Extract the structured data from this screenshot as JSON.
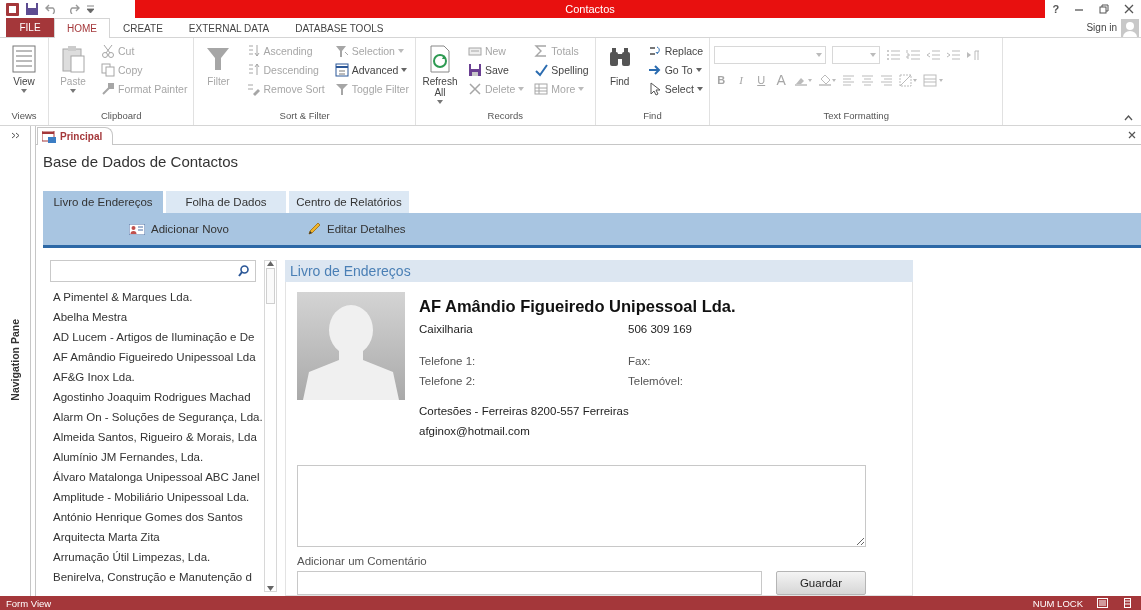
{
  "window": {
    "title": "Contactos",
    "help": "?"
  },
  "ribbon": {
    "file_tab": "FILE",
    "sign_in": "Sign in",
    "tabs": [
      {
        "label": "HOME",
        "selected": true
      },
      {
        "label": "CREATE",
        "selected": false
      },
      {
        "label": "EXTERNAL DATA",
        "selected": false
      },
      {
        "label": "DATABASE TOOLS",
        "selected": false
      }
    ],
    "groups": [
      {
        "name": "Views",
        "commands": [
          {
            "label": "View",
            "kind": "large",
            "disabled": false,
            "dropdown": true
          }
        ]
      },
      {
        "name": "Clipboard",
        "commands": [
          {
            "label": "Paste",
            "kind": "large",
            "disabled": true,
            "dropdown": true
          },
          {
            "label": "Cut",
            "kind": "small",
            "disabled": true,
            "dropdown": false
          },
          {
            "label": "Copy",
            "kind": "small",
            "disabled": true,
            "dropdown": false
          },
          {
            "label": "Format Painter",
            "kind": "small",
            "disabled": true,
            "dropdown": false
          }
        ]
      },
      {
        "name": "Sort & Filter",
        "commands": [
          {
            "label": "Filter",
            "kind": "large",
            "disabled": true,
            "dropdown": false
          },
          {
            "label": "Ascending",
            "kind": "small",
            "disabled": true,
            "dropdown": false
          },
          {
            "label": "Descending",
            "kind": "small",
            "disabled": true,
            "dropdown": false
          },
          {
            "label": "Remove Sort",
            "kind": "small",
            "disabled": true,
            "dropdown": false
          },
          {
            "label": "Selection",
            "kind": "small",
            "disabled": true,
            "dropdown": true
          },
          {
            "label": "Advanced",
            "kind": "small",
            "disabled": false,
            "dropdown": true
          },
          {
            "label": "Toggle Filter",
            "kind": "small",
            "disabled": true,
            "dropdown": false
          }
        ]
      },
      {
        "name": "Records",
        "commands": [
          {
            "label": "Refresh All",
            "kind": "large",
            "disabled": false,
            "dropdown": true
          },
          {
            "label": "New",
            "kind": "small",
            "disabled": true,
            "dropdown": false
          },
          {
            "label": "Save",
            "kind": "small",
            "disabled": false,
            "dropdown": false
          },
          {
            "label": "Delete",
            "kind": "small",
            "disabled": true,
            "dropdown": true
          },
          {
            "label": "Totals",
            "kind": "small",
            "disabled": true,
            "dropdown": false
          },
          {
            "label": "Spelling",
            "kind": "small",
            "disabled": false,
            "dropdown": false
          },
          {
            "label": "More",
            "kind": "small",
            "disabled": true,
            "dropdown": true
          }
        ]
      },
      {
        "name": "Find",
        "commands": [
          {
            "label": "Find",
            "kind": "large",
            "disabled": false,
            "dropdown": false
          },
          {
            "label": "Replace",
            "kind": "small",
            "disabled": false,
            "dropdown": false
          },
          {
            "label": "Go To",
            "kind": "small",
            "disabled": false,
            "dropdown": true
          },
          {
            "label": "Select",
            "kind": "small",
            "disabled": false,
            "dropdown": true
          }
        ]
      },
      {
        "name": "Text Formatting",
        "format_buttons": [
          {
            "label": "B",
            "disabled": true
          },
          {
            "label": "I",
            "disabled": true
          },
          {
            "label": "U",
            "disabled": true
          },
          {
            "label": "A",
            "disabled": true
          }
        ]
      }
    ]
  },
  "navigation_pane": {
    "label": "Navigation Pane"
  },
  "document_tab": {
    "label": "Principal"
  },
  "form": {
    "title": "Base de Dados de Contactos",
    "tabs": [
      {
        "label": "Livro de Endereços",
        "selected": true
      },
      {
        "label": "Folha de Dados",
        "selected": false
      },
      {
        "label": "Centro de Relatórios",
        "selected": false
      }
    ],
    "actions": [
      {
        "label": "Adicionar Novo"
      },
      {
        "label": "Editar Detalhes"
      }
    ],
    "list": {
      "items": [
        "A Pimentel & Marques Lda.",
        "Abelha Mestra",
        "AD Lucem - Artigos de Iluminação e De",
        "AF Amândio Figueiredo Unipessoal Lda",
        "AF&G Inox Lda.",
        "Agostinho Joaquim Rodrigues Machad",
        "Alarm On - Soluções de Segurança, Lda.",
        "Almeida Santos, Rigueiro & Morais, Lda",
        "Alumínio JM Fernandes, Lda.",
        "Álvaro Matalonga Unipessoal ABC Janel",
        "Amplitude - Mobiliário Unipessoal Lda.",
        "António Henrique Gomes dos Santos",
        "Arquitecta Marta Zita",
        "Arrumação Útil Limpezas, Lda.",
        "Benirelva, Construção e Manutenção d"
      ]
    },
    "detail": {
      "header": "Livro de Endereços",
      "name": "AF Amândio Figueiredo Unipessoal Lda.",
      "category": "Caixilharia",
      "tax_id": "506 309 169",
      "fields": [
        {
          "label": "Telefone 1:"
        },
        {
          "label": "Fax:"
        },
        {
          "label": "Telefone 2:"
        },
        {
          "label": "Telemóvel:"
        }
      ],
      "address": "Cortesões - Ferreiras  8200-557 Ferreiras",
      "email": "afginox@hotmail.com",
      "comment_label": "Adicionar um Comentário",
      "save_button": "Guardar"
    }
  },
  "status_bar": {
    "view": "Form View",
    "num_lock": "NUM LOCK"
  }
}
